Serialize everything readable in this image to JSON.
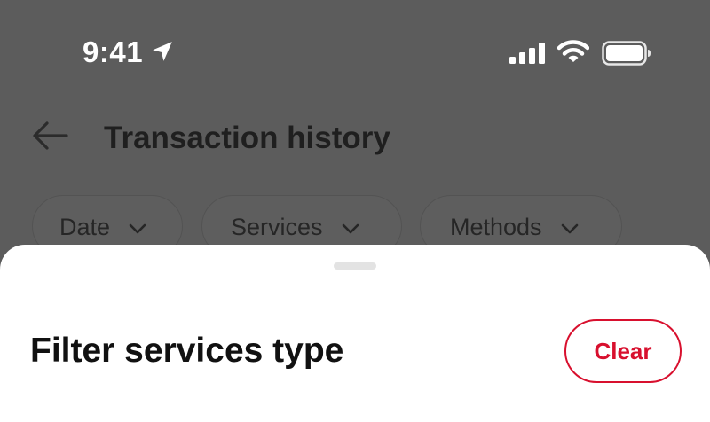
{
  "status_bar": {
    "time": "9:41",
    "icons": [
      "location-arrow-icon",
      "cellular-signal-icon",
      "wifi-icon",
      "battery-icon"
    ]
  },
  "header": {
    "title": "Transaction history",
    "back_icon": "back-arrow-icon"
  },
  "filters": [
    {
      "label": "Date",
      "icon": "chevron-down-icon"
    },
    {
      "label": "Services",
      "icon": "chevron-down-icon"
    },
    {
      "label": "Methods",
      "icon": "chevron-down-icon"
    }
  ],
  "sheet": {
    "title": "Filter services type",
    "clear_label": "Clear"
  },
  "colors": {
    "accent": "#d8102e",
    "overlay_bg": "#5c5c5c",
    "sheet_bg": "#ffffff"
  }
}
